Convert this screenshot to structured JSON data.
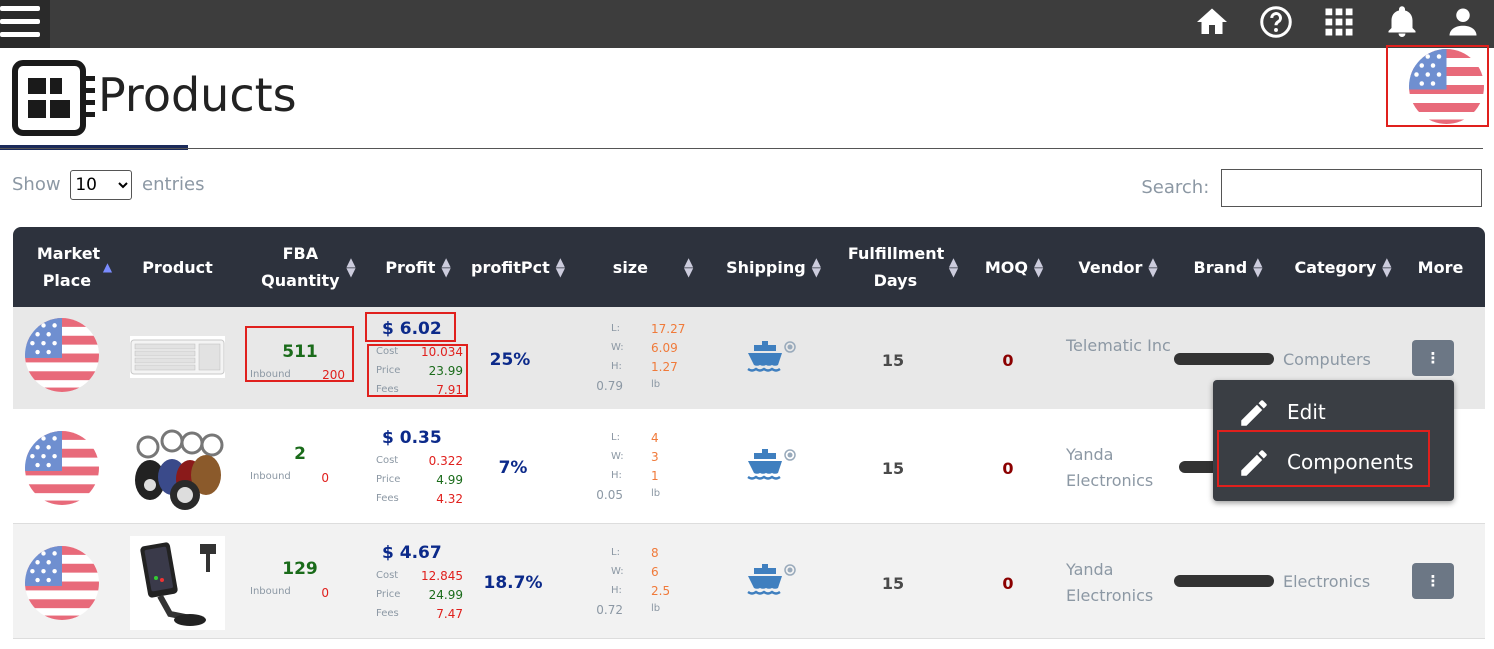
{
  "header": {
    "title": "Products"
  },
  "top_icons": [
    "home-icon",
    "help-icon",
    "apps-grid-icon",
    "bell-icon",
    "user-icon"
  ],
  "controls": {
    "show_label": "Show",
    "entries_value": "10",
    "entries_options": [
      "10"
    ],
    "entries_label": "entries",
    "search_label": "Search:",
    "search_value": ""
  },
  "table": {
    "columns": [
      "Market Place",
      "Product",
      "FBA Quantity",
      "Profit",
      "profitPct",
      "size",
      "Shipping",
      "Fulfillment Days",
      "MOQ",
      "Vendor",
      "Brand",
      "Category",
      "More"
    ],
    "labels": {
      "inbound": "Inbound",
      "cost": "Cost",
      "price": "Price",
      "fees": "Fees",
      "l": "L:",
      "w": "W:",
      "h": "H:",
      "lb": "lb"
    },
    "rows": [
      {
        "fba_quantity": "511",
        "inbound": "200",
        "profit": "$ 6.02",
        "cost": "10.034",
        "price": "23.99",
        "fees": "7.91",
        "profit_pct": "25%",
        "l": "17.27",
        "w": "6.09",
        "h": "1.27",
        "weight": "0.79",
        "days": "15",
        "moq": "0",
        "vendor": "Telematic Inc",
        "category": "Computers",
        "more": "⋮"
      },
      {
        "fba_quantity": "2",
        "inbound": "0",
        "profit": "$ 0.35",
        "cost": "0.322",
        "price": "4.99",
        "fees": "4.32",
        "profit_pct": "7%",
        "l": "4",
        "w": "3",
        "h": "1",
        "weight": "0.05",
        "days": "15",
        "moq": "0",
        "vendor": "Yanda Electronics",
        "category": "",
        "more": "⋮"
      },
      {
        "fba_quantity": "129",
        "inbound": "0",
        "profit": "$ 4.67",
        "cost": "12.845",
        "price": "24.99",
        "fees": "7.47",
        "profit_pct": "18.7%",
        "l": "8",
        "w": "6",
        "h": "2.5",
        "weight": "0.72",
        "days": "15",
        "moq": "0",
        "vendor": "Yanda Electronics",
        "category": "Electronics",
        "more": "⋮"
      }
    ]
  },
  "dropdown": {
    "items": [
      "Edit",
      "Components"
    ]
  },
  "colors": {
    "topbar": "#3d3d3d",
    "table_header": "#2d323d",
    "highlight": "#e0201d",
    "profit": "#0c2a8a",
    "ship": "#3f7fbf"
  }
}
